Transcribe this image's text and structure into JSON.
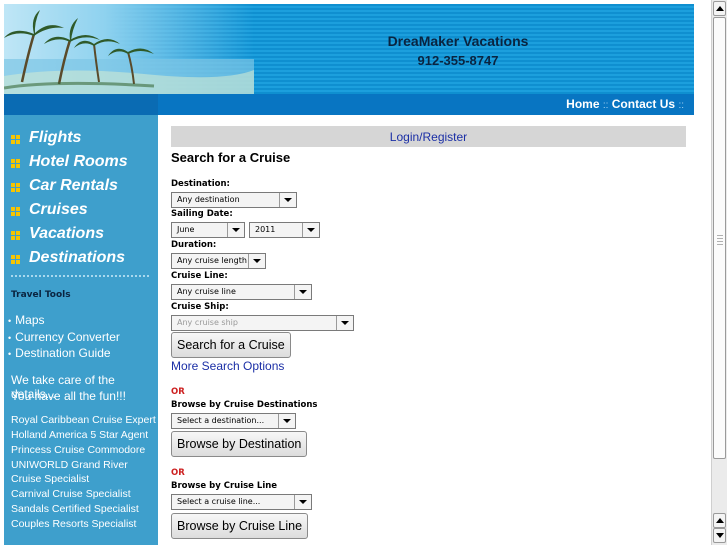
{
  "header": {
    "company": "DreaMaker Vacations",
    "phone": "912-355-8747"
  },
  "nav": {
    "home": "Home",
    "separator": "::",
    "contact": "Contact Us"
  },
  "sidebar": {
    "menu": [
      {
        "label": "Flights"
      },
      {
        "label": "Hotel Rooms"
      },
      {
        "label": "Car Rentals"
      },
      {
        "label": "Cruises"
      },
      {
        "label": "Vacations"
      },
      {
        "label": "Destinations"
      }
    ],
    "tools_heading": "Travel Tools",
    "tools": [
      {
        "label": "Maps"
      },
      {
        "label": "Currency Converter"
      },
      {
        "label": "Destination Guide"
      }
    ],
    "bullet": "•",
    "tagline_1": "We take care of the details...",
    "tagline_2": "You have all the fun!!!",
    "specialties": [
      "Royal Caribbean Cruise Expert",
      "Holland America 5 Star Agent",
      "Princess Cruise Commodore",
      "UNIWORLD Grand River",
      "Cruise Specialist",
      "Carnival Cruise Specialist",
      "Sandals Certified Specialist",
      "Couples Resorts Specialist"
    ]
  },
  "main": {
    "login_label": "Login/Register",
    "search_title": "Search for a Cruise",
    "destination_label": "Destination:",
    "destination_value": "Any destination",
    "sailing_date_label": "Sailing Date:",
    "month_value": "June",
    "year_value": "2011",
    "duration_label": "Duration:",
    "duration_value": "Any cruise length",
    "cruise_line_label": "Cruise Line:",
    "cruise_line_value": "Any cruise line",
    "cruise_ship_label": "Cruise Ship:",
    "cruise_ship_value": "Any cruise ship",
    "search_button": "Search for a Cruise",
    "more_options": "More Search Options",
    "or_label": "OR",
    "browse_dest_label": "Browse by Cruise Destinations",
    "browse_dest_select": "Select a destination...",
    "browse_dest_button": "Browse by Destination",
    "browse_line_label": "Browse by Cruise Line",
    "browse_line_select": "Select a cruise line...",
    "browse_line_button": "Browse by Cruise Line"
  },
  "colors": {
    "header_blue": "#1c9fdd",
    "nav_blue": "#0875c2",
    "sidebar_blue": "#3e9fcc",
    "link_blue": "#1b2fa6",
    "or_red": "#cc1f1f",
    "menu_square": "#f6c400"
  },
  "icons": [
    "scroll-up-icon",
    "scroll-down-icon",
    "menu-square-icon",
    "palm-tree-image"
  ]
}
